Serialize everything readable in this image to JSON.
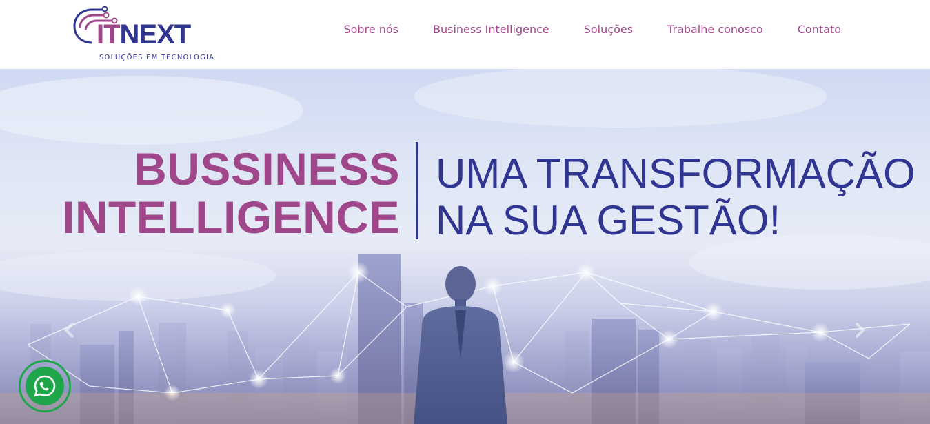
{
  "header": {
    "logo": {
      "word_part1": "IT",
      "word_part2": "NEXT",
      "tagline": "SOLUÇÕES EM TECNOLOGIA"
    },
    "nav": [
      {
        "label": "Sobre nós"
      },
      {
        "label": "Business Intelligence"
      },
      {
        "label": "Soluções"
      },
      {
        "label": "Trabalhe conosco"
      },
      {
        "label": "Contato"
      }
    ]
  },
  "hero": {
    "headline_left": [
      "BUSSINESS",
      "INTELLIGENCE"
    ],
    "headline_right": [
      "UMA TRANSFORMAÇÃO",
      "NA SUA GESTÃO!"
    ],
    "prev_icon": "chevron-left-icon",
    "next_icon": "chevron-right-icon"
  },
  "whatsapp": {
    "icon": "whatsapp-icon"
  },
  "colors": {
    "brand_purple": "#a0478c",
    "brand_navy": "#2f3590",
    "whatsapp_green": "#1fa64b"
  }
}
